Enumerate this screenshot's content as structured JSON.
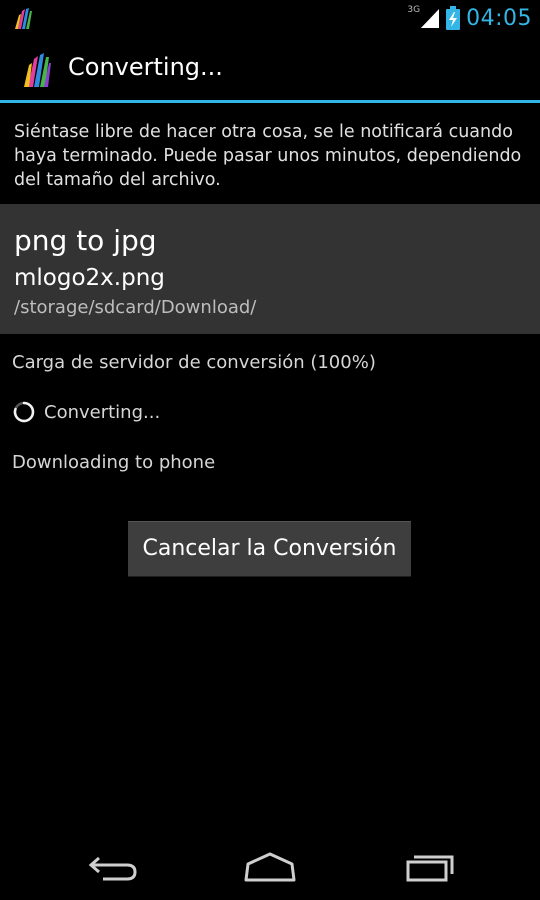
{
  "statusbar": {
    "network_label": "3G",
    "time": "04:05",
    "icons": [
      "app-notification-icon",
      "signal-icon",
      "battery-charging-icon"
    ]
  },
  "actionbar": {
    "app_icon": "app-logo-icon",
    "title": "Converting..."
  },
  "info_text": "Siéntase libre de hacer otra cosa, se le notificará cuando haya terminado. Puede pasar unos minutos, dependiendo del tamaño del archivo.",
  "file": {
    "conversion": "png to jpg",
    "name": "mlogo2x.png",
    "path": "/storage/sdcard/Download/"
  },
  "progress": {
    "upload": "Carga de servidor de conversión (100%)",
    "converting": "Converting...",
    "downloading": "Downloading to phone"
  },
  "cancel_button": "Cancelar la Conversión",
  "navbar": {
    "icons": [
      "back-icon",
      "home-icon",
      "recent-apps-icon"
    ]
  },
  "colors": {
    "accent": "#33b5e5",
    "panel": "#333333",
    "background": "#000000"
  }
}
